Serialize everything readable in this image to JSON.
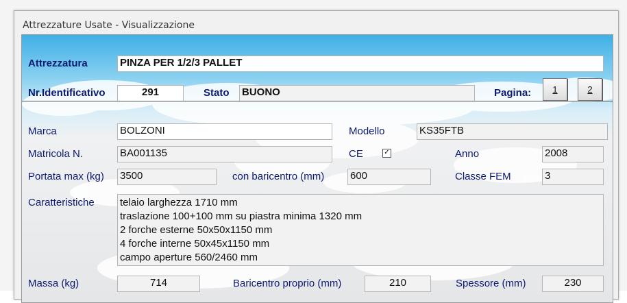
{
  "window": {
    "title": "Attrezzature Usate - Visualizzazione"
  },
  "header": {
    "attrezzatura_label": "Attrezzatura",
    "attrezzatura_value": "PINZA PER 1/2/3 PALLET",
    "nr_label": "Nr.Identificativo",
    "nr_value": "291",
    "stato_label": "Stato",
    "stato_value": "BUONO",
    "pagina_label": "Pagina:",
    "page_buttons": [
      "1",
      "2"
    ]
  },
  "details": {
    "marca_label": "Marca",
    "marca_value": "BOLZONI",
    "modello_label": "Modello",
    "modello_value": "KS35FTB",
    "matricola_label": "Matricola N.",
    "matricola_value": "BA001135",
    "ce_label": "CE",
    "ce_checked": true,
    "ce_check_glyph": "✓",
    "anno_label": "Anno",
    "anno_value": "2008",
    "portata_label": "Portata max (kg)",
    "portata_value": "3500",
    "baricentro_label": "con baricentro (mm)",
    "baricentro_value": "600",
    "classe_label": "Classe FEM",
    "classe_value": "3",
    "caratteristiche_label": "Caratteristiche",
    "caratteristiche_lines": [
      "telaio larghezza 1710 mm",
      "traslazione 100+100 mm su piastra minima 1320 mm",
      "2 forche esterne 50x50x1150 mm",
      "4 forche interne 50x45x1150 mm",
      "campo aperture 560/2460 mm"
    ],
    "massa_label": "Massa (kg)",
    "massa_value": "714",
    "baricentro_proprio_label": "Baricentro proprio (mm)",
    "baricentro_proprio_value": "210",
    "spessore_label": "Spessore (mm)",
    "spessore_value": "230"
  },
  "colors": {
    "label": "#0c1a70",
    "sky_top": "#3fb0e6",
    "panel": "#f1f1f1"
  }
}
